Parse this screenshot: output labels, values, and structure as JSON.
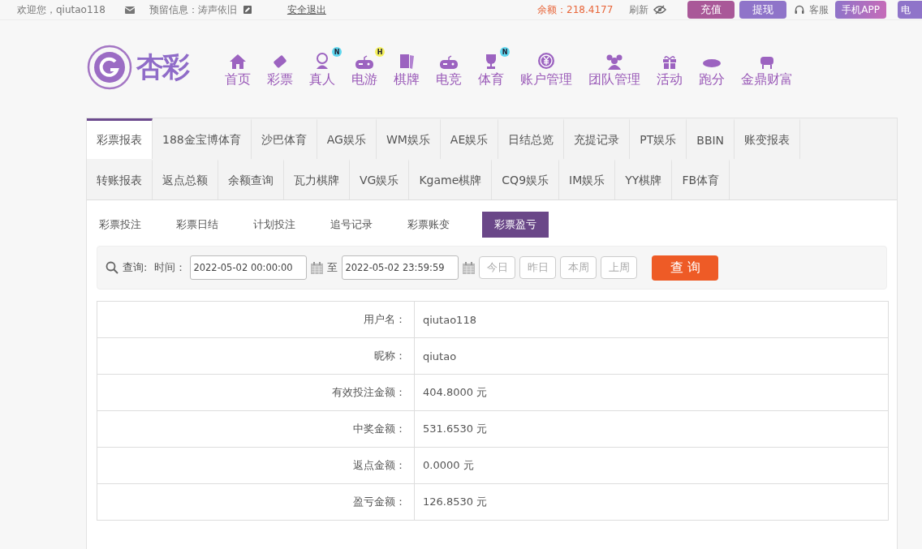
{
  "top_bar": {
    "welcome": "欢迎您，qiutao118",
    "reserved_info": "预留信息：涛声依旧",
    "logout": "安全退出",
    "balance": "余额：218.4177",
    "refresh": "刷新",
    "buttons": [
      {
        "label": "充值",
        "kind": "deposit"
      },
      {
        "label": "提现",
        "kind": "withdraw"
      }
    ],
    "service": "客服",
    "app_buttons": [
      {
        "label": "手机APP"
      },
      {
        "label": "电"
      }
    ]
  },
  "logo": {
    "text": "杏彩"
  },
  "nav": [
    {
      "label": "首页"
    },
    {
      "label": "彩票"
    },
    {
      "label": "真人",
      "badge": "N"
    },
    {
      "label": "电游",
      "badge": "H"
    },
    {
      "label": "棋牌"
    },
    {
      "label": "电竞"
    },
    {
      "label": "体育",
      "badge": "N"
    },
    {
      "label": "账户管理"
    },
    {
      "label": "团队管理"
    },
    {
      "label": "活动"
    },
    {
      "label": "跑分"
    },
    {
      "label": "金鼎财富"
    }
  ],
  "report_tab_rows": [
    {
      "tabs": [
        {
          "label": "彩票报表",
          "selected": true
        },
        {
          "label": "188金宝博体育",
          "selected": false
        },
        {
          "label": "沙巴体育",
          "selected": false
        },
        {
          "label": "AG娱乐",
          "selected": false
        },
        {
          "label": "WM娱乐",
          "selected": false
        },
        {
          "label": "AE娱乐",
          "selected": false
        },
        {
          "label": "日结总览",
          "selected": false
        },
        {
          "label": "充提记录",
          "selected": false
        },
        {
          "label": "PT娱乐",
          "selected": false
        },
        {
          "label": "BBIN",
          "selected": false
        },
        {
          "label": "账变报表",
          "selected": false
        }
      ]
    },
    {
      "tabs": [
        {
          "label": "转账报表",
          "selected": false
        },
        {
          "label": "返点总额",
          "selected": false
        },
        {
          "label": "余额查询",
          "selected": false
        },
        {
          "label": "瓦力棋牌",
          "selected": false
        },
        {
          "label": "VG娱乐",
          "selected": false
        },
        {
          "label": "Kgame棋牌",
          "selected": false
        },
        {
          "label": "CQ9娱乐",
          "selected": false
        },
        {
          "label": "IM娱乐",
          "selected": false
        },
        {
          "label": "YY棋牌",
          "selected": false
        },
        {
          "label": "FB体育",
          "selected": false
        }
      ]
    }
  ],
  "sub_tabs": [
    {
      "label": "彩票投注",
      "selected": false
    },
    {
      "label": "彩票日结",
      "selected": false
    },
    {
      "label": "计划投注",
      "selected": false
    },
    {
      "label": "追号记录",
      "selected": false
    },
    {
      "label": "彩票账变",
      "selected": false
    },
    {
      "label": "彩票盈亏",
      "selected": true
    }
  ],
  "query": {
    "label": "查询:",
    "time_label": "时间：",
    "start": "2022-05-02 00:00:00",
    "to": "至",
    "end": "2022-05-02 23:59:59",
    "quick_buttons": [
      "今日",
      "昨日",
      "本周",
      "上周"
    ],
    "submit": "查 询"
  },
  "summary": [
    {
      "label": "用户名：",
      "value": "qiutao118"
    },
    {
      "label": "昵称：",
      "value": "qiutao"
    },
    {
      "label": "有效投注金额：",
      "value": "404.8000 元"
    },
    {
      "label": "中奖金额：",
      "value": "531.6530 元"
    },
    {
      "label": "返点金额：",
      "value": "0.0000 元"
    },
    {
      "label": "盈亏金额：",
      "value": "126.8530 元"
    }
  ]
}
